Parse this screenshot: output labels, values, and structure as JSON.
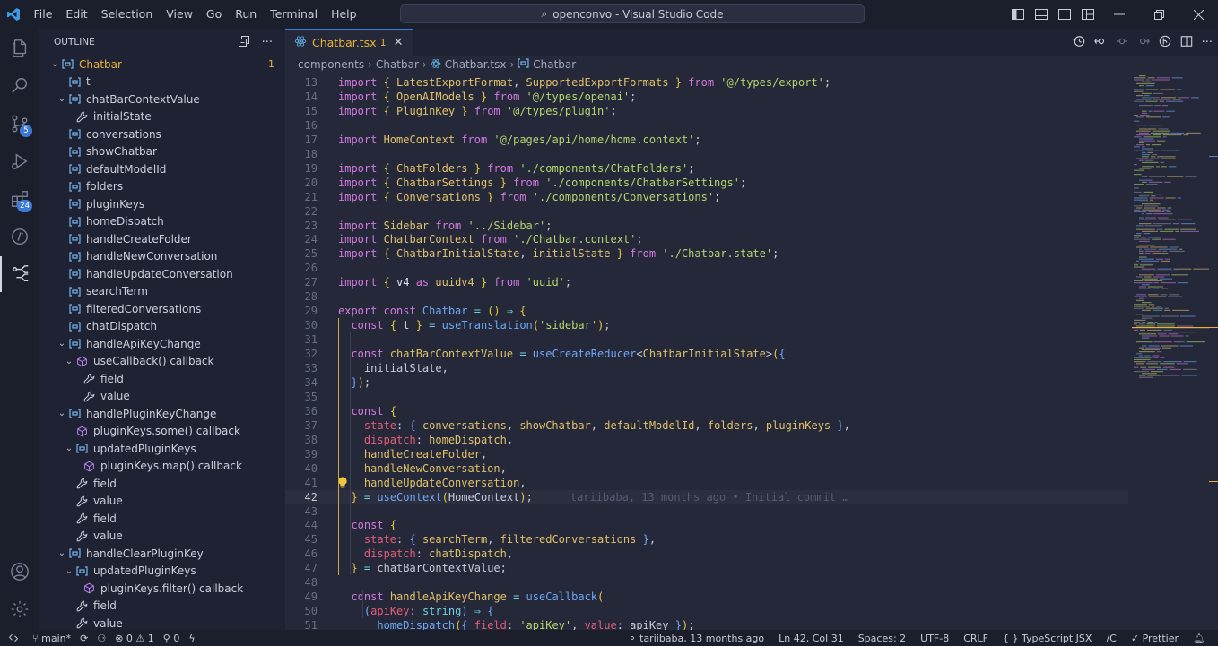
{
  "window_title": "openconvo - Visual Studio Code",
  "menu": [
    "File",
    "Edit",
    "Selection",
    "View",
    "Go",
    "Run",
    "Terminal",
    "Help"
  ],
  "activity": {
    "scm_badge": "5",
    "extensions_badge": "24"
  },
  "outline": {
    "title": "OUTLINE",
    "items": [
      {
        "label": "Chatbar",
        "indent": 0,
        "chev": "v",
        "icon": "var",
        "count": "1"
      },
      {
        "label": "t",
        "indent": 1,
        "chev": "",
        "icon": "var"
      },
      {
        "label": "chatBarContextValue",
        "indent": 1,
        "chev": "v",
        "icon": "var"
      },
      {
        "label": "initialState",
        "indent": 2,
        "chev": "",
        "icon": "prop"
      },
      {
        "label": "conversations",
        "indent": 1,
        "chev": "",
        "icon": "var"
      },
      {
        "label": "showChatbar",
        "indent": 1,
        "chev": "",
        "icon": "var"
      },
      {
        "label": "defaultModelId",
        "indent": 1,
        "chev": "",
        "icon": "var"
      },
      {
        "label": "folders",
        "indent": 1,
        "chev": "",
        "icon": "var"
      },
      {
        "label": "pluginKeys",
        "indent": 1,
        "chev": "",
        "icon": "var"
      },
      {
        "label": "homeDispatch",
        "indent": 1,
        "chev": "",
        "icon": "var"
      },
      {
        "label": "handleCreateFolder",
        "indent": 1,
        "chev": "",
        "icon": "var"
      },
      {
        "label": "handleNewConversation",
        "indent": 1,
        "chev": "",
        "icon": "var"
      },
      {
        "label": "handleUpdateConversation",
        "indent": 1,
        "chev": "",
        "icon": "var"
      },
      {
        "label": "searchTerm",
        "indent": 1,
        "chev": "",
        "icon": "var"
      },
      {
        "label": "filteredConversations",
        "indent": 1,
        "chev": "",
        "icon": "var"
      },
      {
        "label": "chatDispatch",
        "indent": 1,
        "chev": "",
        "icon": "var"
      },
      {
        "label": "handleApiKeyChange",
        "indent": 1,
        "chev": "v",
        "icon": "var"
      },
      {
        "label": "useCallback() callback",
        "indent": 2,
        "chev": "v",
        "icon": "method"
      },
      {
        "label": "field",
        "indent": 3,
        "chev": "",
        "icon": "prop"
      },
      {
        "label": "value",
        "indent": 3,
        "chev": "",
        "icon": "prop"
      },
      {
        "label": "handlePluginKeyChange",
        "indent": 1,
        "chev": "v",
        "icon": "var"
      },
      {
        "label": "pluginKeys.some() callback",
        "indent": 2,
        "chev": "",
        "icon": "method"
      },
      {
        "label": "updatedPluginKeys",
        "indent": 2,
        "chev": "v",
        "icon": "var"
      },
      {
        "label": "pluginKeys.map() callback",
        "indent": 3,
        "chev": "",
        "icon": "method"
      },
      {
        "label": "field",
        "indent": 2,
        "chev": "",
        "icon": "prop"
      },
      {
        "label": "value",
        "indent": 2,
        "chev": "",
        "icon": "prop"
      },
      {
        "label": "field",
        "indent": 2,
        "chev": "",
        "icon": "prop"
      },
      {
        "label": "value",
        "indent": 2,
        "chev": "",
        "icon": "prop"
      },
      {
        "label": "handleClearPluginKey",
        "indent": 1,
        "chev": "v",
        "icon": "var"
      },
      {
        "label": "updatedPluginKeys",
        "indent": 2,
        "chev": "v",
        "icon": "var"
      },
      {
        "label": "pluginKeys.filter() callback",
        "indent": 3,
        "chev": "",
        "icon": "method"
      },
      {
        "label": "field",
        "indent": 2,
        "chev": "",
        "icon": "prop"
      },
      {
        "label": "value",
        "indent": 2,
        "chev": "",
        "icon": "prop"
      }
    ]
  },
  "tab": {
    "name": "Chatbar.tsx",
    "problems": "1"
  },
  "breadcrumbs": [
    "components",
    "Chatbar",
    "Chatbar.tsx",
    "Chatbar"
  ],
  "code": [
    {
      "n": "13",
      "t": [
        [
          "kw",
          "import "
        ],
        [
          "br",
          "{ "
        ],
        [
          "ty",
          "LatestExportFormat"
        ],
        [
          "pu",
          ", "
        ],
        [
          "ty",
          "SupportedExportFormats"
        ],
        [
          "br",
          " }"
        ],
        [
          "kw",
          " from "
        ],
        [
          "st",
          "'@/types/export'"
        ],
        [
          "pu",
          ";"
        ]
      ]
    },
    {
      "n": "14",
      "t": [
        [
          "kw",
          "import "
        ],
        [
          "br",
          "{ "
        ],
        [
          "ty",
          "OpenAIModels"
        ],
        [
          "br",
          " }"
        ],
        [
          "kw",
          " from "
        ],
        [
          "st",
          "'@/types/openai'"
        ],
        [
          "pu",
          ";"
        ]
      ]
    },
    {
      "n": "15",
      "t": [
        [
          "kw",
          "import "
        ],
        [
          "br",
          "{ "
        ],
        [
          "ty",
          "PluginKey"
        ],
        [
          "br",
          " }"
        ],
        [
          "kw",
          " from "
        ],
        [
          "st",
          "'@/types/plugin'"
        ],
        [
          "pu",
          ";"
        ]
      ]
    },
    {
      "n": "16",
      "t": []
    },
    {
      "n": "17",
      "t": [
        [
          "kw",
          "import "
        ],
        [
          "ty",
          "HomeContext"
        ],
        [
          "kw",
          " from "
        ],
        [
          "st",
          "'@/pages/api/home/home.context'"
        ],
        [
          "pu",
          ";"
        ]
      ]
    },
    {
      "n": "18",
      "t": []
    },
    {
      "n": "19",
      "t": [
        [
          "kw",
          "import "
        ],
        [
          "br",
          "{ "
        ],
        [
          "ty",
          "ChatFolders"
        ],
        [
          "br",
          " }"
        ],
        [
          "kw",
          " from "
        ],
        [
          "st",
          "'./components/ChatFolders'"
        ],
        [
          "pu",
          ";"
        ]
      ]
    },
    {
      "n": "20",
      "t": [
        [
          "kw",
          "import "
        ],
        [
          "br",
          "{ "
        ],
        [
          "ty",
          "ChatbarSettings"
        ],
        [
          "br",
          " }"
        ],
        [
          "kw",
          " from "
        ],
        [
          "st",
          "'./components/ChatbarSettings'"
        ],
        [
          "pu",
          ";"
        ]
      ]
    },
    {
      "n": "21",
      "t": [
        [
          "kw",
          "import "
        ],
        [
          "br",
          "{ "
        ],
        [
          "ty",
          "Conversations"
        ],
        [
          "br",
          " }"
        ],
        [
          "kw",
          " from "
        ],
        [
          "st",
          "'./components/Conversations'"
        ],
        [
          "pu",
          ";"
        ]
      ]
    },
    {
      "n": "22",
      "t": []
    },
    {
      "n": "23",
      "t": [
        [
          "kw",
          "import "
        ],
        [
          "ty",
          "Sidebar"
        ],
        [
          "kw",
          " from "
        ],
        [
          "st",
          "'../Sidebar'"
        ],
        [
          "pu",
          ";"
        ]
      ]
    },
    {
      "n": "24",
      "t": [
        [
          "kw",
          "import "
        ],
        [
          "ty",
          "ChatbarContext"
        ],
        [
          "kw",
          " from "
        ],
        [
          "st",
          "'./Chatbar.context'"
        ],
        [
          "pu",
          ";"
        ]
      ]
    },
    {
      "n": "25",
      "t": [
        [
          "kw",
          "import "
        ],
        [
          "br",
          "{ "
        ],
        [
          "ty",
          "ChatbarInitialState"
        ],
        [
          "pu",
          ", "
        ],
        [
          "ty",
          "initialState"
        ],
        [
          "br",
          " }"
        ],
        [
          "kw",
          " from "
        ],
        [
          "st",
          "'./Chatbar.state'"
        ],
        [
          "pu",
          ";"
        ]
      ]
    },
    {
      "n": "26",
      "t": []
    },
    {
      "n": "27",
      "t": [
        [
          "kw",
          "import "
        ],
        [
          "br",
          "{ "
        ],
        [
          "va",
          "v4"
        ],
        [
          "kw",
          " as "
        ],
        [
          "ty",
          "uuidv4"
        ],
        [
          "br",
          " }"
        ],
        [
          "kw",
          " from "
        ],
        [
          "st",
          "'uuid'"
        ],
        [
          "pu",
          ";"
        ]
      ]
    },
    {
      "n": "28",
      "t": []
    },
    {
      "n": "29",
      "t": [
        [
          "kw",
          "export const "
        ],
        [
          "fn",
          "Chatbar"
        ],
        [
          "op",
          " = "
        ],
        [
          "br",
          "()"
        ],
        [
          "op",
          " ⇒ "
        ],
        [
          "br",
          "{"
        ]
      ]
    },
    {
      "n": "30",
      "t": [
        [
          "pu",
          "  "
        ],
        [
          "kw",
          "const "
        ],
        [
          "br",
          "{ "
        ],
        [
          "va",
          "t"
        ],
        [
          "br",
          " }"
        ],
        [
          "op",
          " = "
        ],
        [
          "fn",
          "useTranslation"
        ],
        [
          "br",
          "("
        ],
        [
          "st",
          "'sidebar'"
        ],
        [
          "br",
          ")"
        ],
        [
          "pu",
          ";"
        ]
      ]
    },
    {
      "n": "31",
      "t": []
    },
    {
      "n": "32",
      "t": [
        [
          "pu",
          "  "
        ],
        [
          "kw",
          "const "
        ],
        [
          "ty",
          "chatBarContextValue"
        ],
        [
          "op",
          " = "
        ],
        [
          "fn",
          "useCreateReducer"
        ],
        [
          "pu",
          "<"
        ],
        [
          "ty",
          "ChatbarInitialState"
        ],
        [
          "pu",
          ">"
        ],
        [
          "br",
          "("
        ],
        [
          "fn",
          "{"
        ]
      ]
    },
    {
      "n": "33",
      "t": [
        [
          "pu",
          "    initialState,"
        ]
      ]
    },
    {
      "n": "34",
      "t": [
        [
          "pu",
          "  "
        ],
        [
          "fn",
          "}"
        ],
        [
          "br",
          ")"
        ],
        [
          "pu",
          ";"
        ]
      ]
    },
    {
      "n": "35",
      "t": []
    },
    {
      "n": "36",
      "t": [
        [
          "pu",
          "  "
        ],
        [
          "kw",
          "const "
        ],
        [
          "br",
          "{"
        ]
      ]
    },
    {
      "n": "37",
      "t": [
        [
          "pu",
          "    "
        ],
        [
          "pr",
          "state"
        ],
        [
          "pu",
          ": "
        ],
        [
          "fn",
          "{ "
        ],
        [
          "ty",
          "conversations"
        ],
        [
          "pu",
          ", "
        ],
        [
          "ty",
          "showChatbar"
        ],
        [
          "pu",
          ", "
        ],
        [
          "ty",
          "defaultModelId"
        ],
        [
          "pu",
          ", "
        ],
        [
          "ty",
          "folders"
        ],
        [
          "pu",
          ", "
        ],
        [
          "ty",
          "pluginKeys"
        ],
        [
          "fn",
          " }"
        ],
        [
          "pu",
          ","
        ]
      ]
    },
    {
      "n": "38",
      "t": [
        [
          "pu",
          "    "
        ],
        [
          "pr",
          "dispatch"
        ],
        [
          "pu",
          ": "
        ],
        [
          "ty",
          "homeDispatch"
        ],
        [
          "pu",
          ","
        ]
      ]
    },
    {
      "n": "39",
      "t": [
        [
          "pu",
          "    "
        ],
        [
          "ty",
          "handleCreateFolder"
        ],
        [
          "pu",
          ","
        ]
      ]
    },
    {
      "n": "40",
      "t": [
        [
          "pu",
          "    "
        ],
        [
          "ty",
          "handleNewConversation"
        ],
        [
          "pu",
          ","
        ]
      ]
    },
    {
      "n": "41",
      "t": [
        [
          "pu",
          "    "
        ],
        [
          "ty",
          "handleUpdateConversation"
        ],
        [
          "pu",
          ","
        ]
      ]
    },
    {
      "n": "42",
      "t": [
        [
          "pu",
          "  "
        ],
        [
          "br",
          "}"
        ],
        [
          "op",
          " = "
        ],
        [
          "fn",
          "useContext"
        ],
        [
          "br",
          "("
        ],
        [
          "pu",
          "HomeContext"
        ],
        [
          "br",
          ")"
        ],
        [
          "pu",
          ";"
        ]
      ],
      "blame": "tariibaba, 13 months ago • Initial commit …",
      "cur": true
    },
    {
      "n": "43",
      "t": []
    },
    {
      "n": "44",
      "t": [
        [
          "pu",
          "  "
        ],
        [
          "kw",
          "const "
        ],
        [
          "br",
          "{"
        ]
      ]
    },
    {
      "n": "45",
      "t": [
        [
          "pu",
          "    "
        ],
        [
          "pr",
          "state"
        ],
        [
          "pu",
          ": "
        ],
        [
          "fn",
          "{ "
        ],
        [
          "ty",
          "searchTerm"
        ],
        [
          "pu",
          ", "
        ],
        [
          "ty",
          "filteredConversations"
        ],
        [
          "fn",
          " }"
        ],
        [
          "pu",
          ","
        ]
      ]
    },
    {
      "n": "46",
      "t": [
        [
          "pu",
          "    "
        ],
        [
          "pr",
          "dispatch"
        ],
        [
          "pu",
          ": "
        ],
        [
          "ty",
          "chatDispatch"
        ],
        [
          "pu",
          ","
        ]
      ]
    },
    {
      "n": "47",
      "t": [
        [
          "pu",
          "  "
        ],
        [
          "br",
          "}"
        ],
        [
          "op",
          " = "
        ],
        [
          "pu",
          "chatBarContextValue;"
        ]
      ]
    },
    {
      "n": "48",
      "t": []
    },
    {
      "n": "49",
      "t": [
        [
          "pu",
          "  "
        ],
        [
          "kw",
          "const "
        ],
        [
          "ty",
          "handleApiKeyChange"
        ],
        [
          "op",
          " = "
        ],
        [
          "fn",
          "useCallback"
        ],
        [
          "br",
          "("
        ]
      ]
    },
    {
      "n": "50",
      "t": [
        [
          "pu",
          "    "
        ],
        [
          "fn",
          "("
        ],
        [
          "pr",
          "apiKey"
        ],
        [
          "pu",
          ": "
        ],
        [
          "op",
          "string"
        ],
        [
          "fn",
          ")"
        ],
        [
          "op",
          " ⇒ "
        ],
        [
          "fn",
          "{"
        ]
      ]
    },
    {
      "n": "51",
      "t": [
        [
          "pu",
          "      "
        ],
        [
          "fn",
          "homeDispatch"
        ],
        [
          "br",
          "("
        ],
        [
          "fn",
          "{ "
        ],
        [
          "pr",
          "field"
        ],
        [
          "pu",
          ": "
        ],
        [
          "st",
          "'apiKey'"
        ],
        [
          "pu",
          ", "
        ],
        [
          "pr",
          "value"
        ],
        [
          "pu",
          ": apiKey "
        ],
        [
          "fn",
          "}"
        ],
        [
          "br",
          ")"
        ],
        [
          "pu",
          ";"
        ]
      ]
    }
  ],
  "status": {
    "branch": "main*",
    "errors": "0",
    "warnings": "1",
    "ports": "0",
    "blame": "tariibaba, 13 months ago",
    "position": "Ln 42, Col 31",
    "spaces": "Spaces: 2",
    "encoding": "UTF-8",
    "eol": "CRLF",
    "language": "TypeScript JSX",
    "ext": "/C",
    "prettier": "Prettier"
  },
  "colors": {
    "accent": "#3a7bd5",
    "warning": "#e8b23c"
  }
}
